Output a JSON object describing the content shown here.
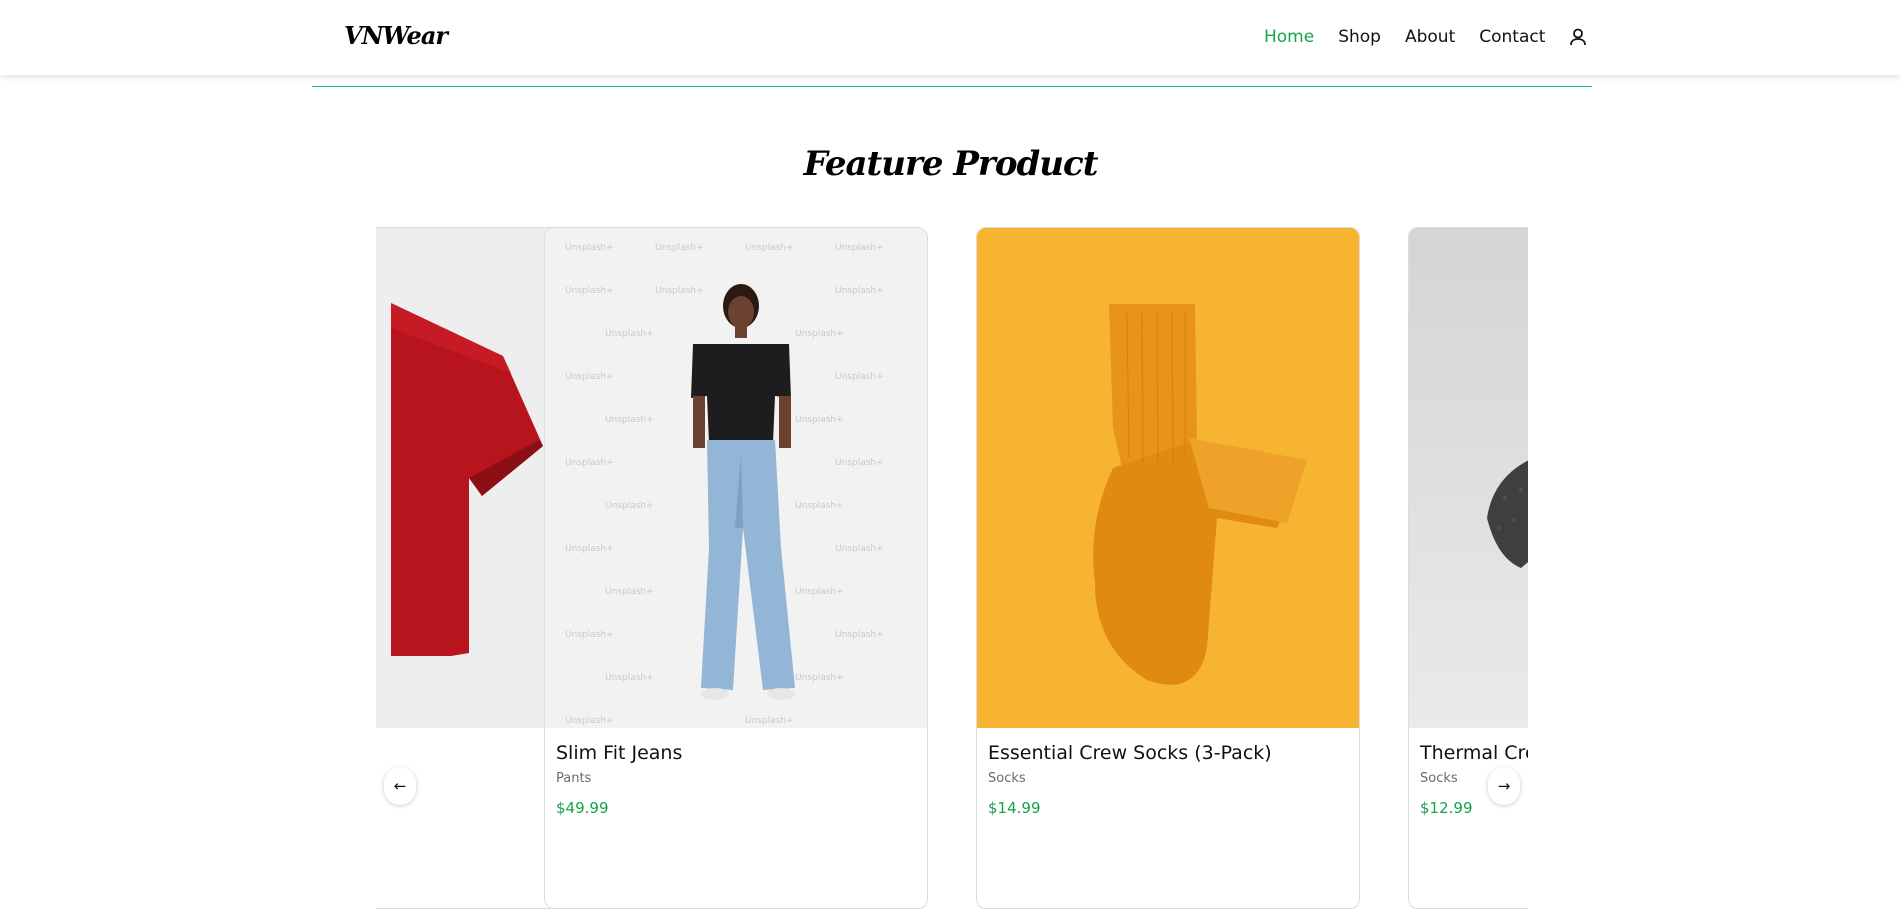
{
  "header": {
    "logo": "VNWear",
    "nav": [
      {
        "label": "Home",
        "active": true
      },
      {
        "label": "Shop",
        "active": false
      },
      {
        "label": "About",
        "active": false
      },
      {
        "label": "Contact",
        "active": false
      }
    ],
    "icons": {
      "account": "user-icon"
    }
  },
  "section": {
    "title": "Feature Product"
  },
  "carousel": {
    "prev_label": "←",
    "next_label": "→",
    "products": [
      {
        "name": "",
        "category": "",
        "price": "",
        "image": "red-tshirt"
      },
      {
        "name": "Slim Fit Jeans",
        "category": "Pants",
        "price": "$49.99",
        "image": "woman-black-tee-blue-jeans",
        "watermark": "Unsplash+"
      },
      {
        "name": "Essential Crew Socks (3-Pack)",
        "category": "Socks",
        "price": "$14.99",
        "image": "orange-socks-on-yellow"
      },
      {
        "name": "Thermal Cre",
        "category": "Socks",
        "price": "$12.99",
        "image": "gray-thermal-sock"
      }
    ]
  },
  "colors": {
    "accent": "#16a34a",
    "divider": "#1aaea0",
    "card_border": "#dcdcdc",
    "sock_background": "#f7b431",
    "sock": "#e8941a"
  }
}
